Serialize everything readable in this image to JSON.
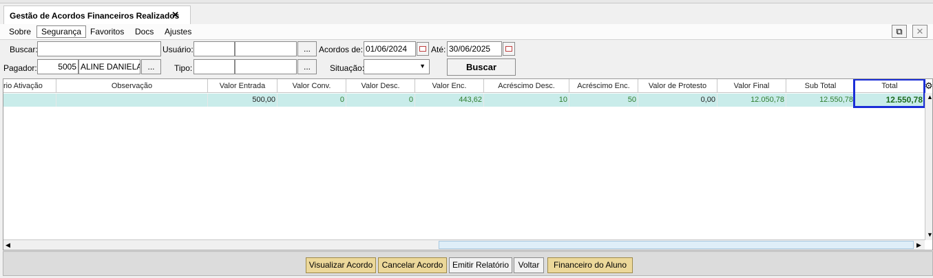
{
  "tab": {
    "title": "Gestão de Acordos Financeiros Realizados",
    "close": "✕"
  },
  "menu": [
    "Sobre",
    "Segurança",
    "Favoritos",
    "Docs",
    "Ajustes"
  ],
  "window_buttons": {
    "external": "⧉",
    "close": "✕"
  },
  "filters": {
    "buscar_label": "Buscar:",
    "buscar_value": "",
    "usuario_label": "Usuário:",
    "usuario_code": "",
    "usuario_name": "",
    "ellipsis": "...",
    "acordos_label": "Acordos de:",
    "date_from": "01/06/2024",
    "ate_label": "Até:",
    "date_to": "30/06/2025",
    "pagador_label": "Pagador:",
    "pagador_code": "5005",
    "pagador_name": "ALINE DANIELA",
    "tipo_label": "Tipo:",
    "tipo_code": "",
    "tipo_name": "",
    "situacao_label": "Situação:",
    "situacao_value": "",
    "buscar_button": "Buscar"
  },
  "table": {
    "columns": [
      "rio Ativação",
      "Observação",
      "Valor Entrada",
      "Valor Conv.",
      "Valor Desc.",
      "Valor Enc.",
      "Acréscimo Desc.",
      "Acréscimo Enc.",
      "Valor de Protesto",
      "Valor Final",
      "Sub Total",
      "Total"
    ],
    "rows": [
      [
        "",
        "",
        "500,00",
        "0",
        "0",
        "443,62",
        "10",
        "50",
        "0,00",
        "12.050,78",
        "12.550,78",
        "12.550,78"
      ]
    ]
  },
  "footer": {
    "visualizar": "Visualizar Acordo",
    "cancelar": "Cancelar Acordo",
    "emitir": "Emitir Relatório",
    "voltar": "Voltar",
    "financeiro": "Financeiro do Aluno"
  },
  "colors": {
    "row_bg": "#c9ecea",
    "highlight": "#1a2ed8",
    "gold_button": "#ecd89a"
  }
}
